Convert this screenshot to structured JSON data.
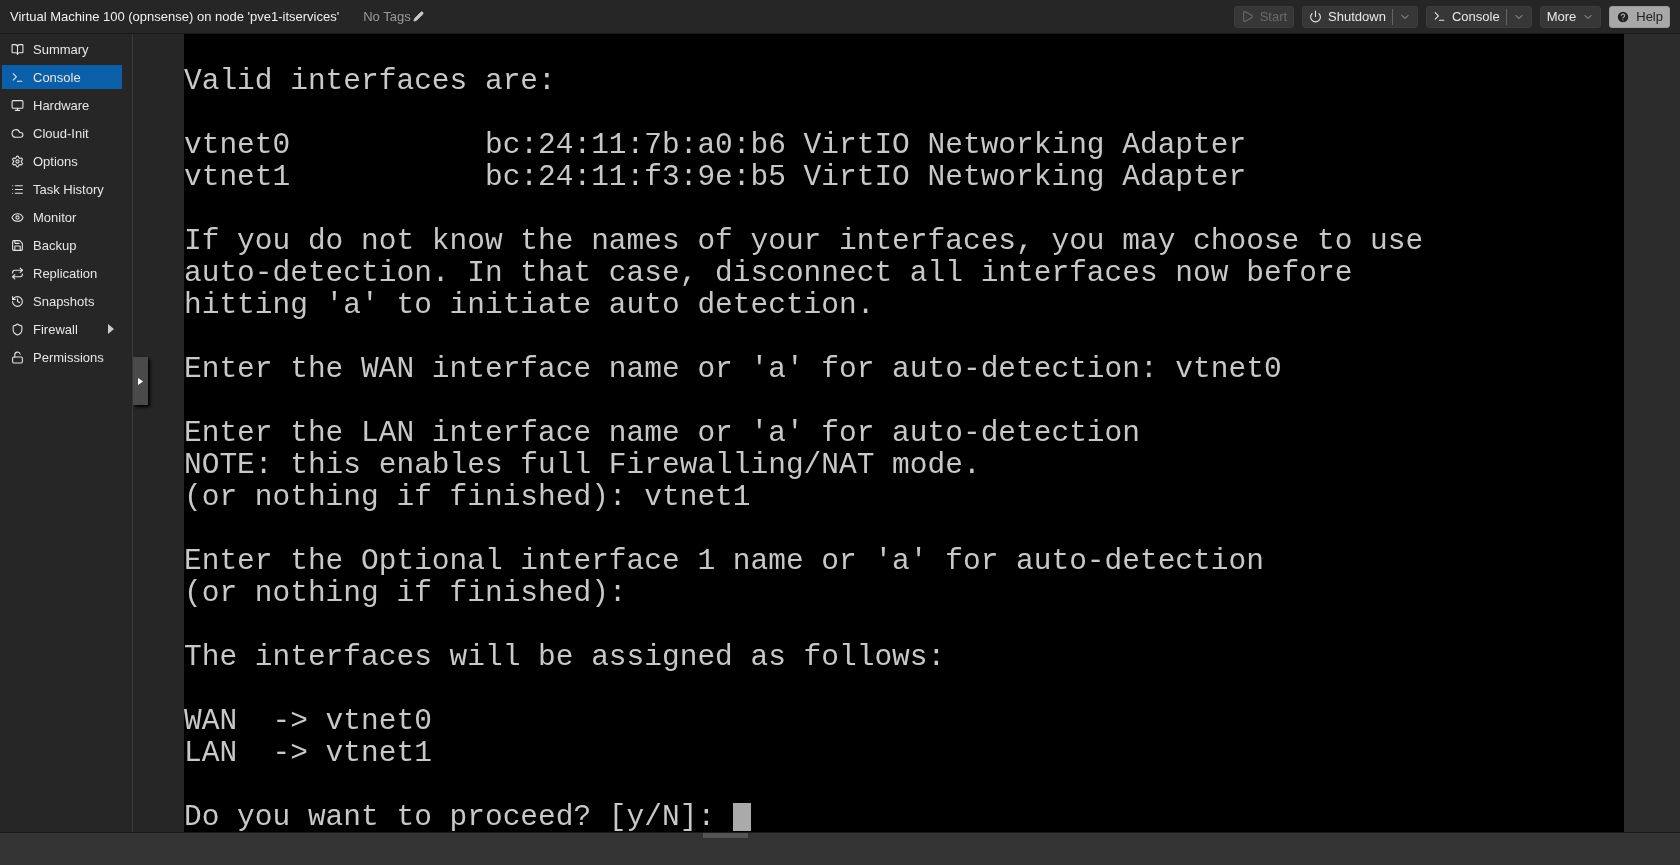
{
  "header": {
    "title": "Virtual Machine 100 (opnsense) on node 'pve1-itservices'",
    "tags": "No Tags"
  },
  "toolbar": [
    {
      "kind": "start",
      "label": "Start",
      "disabled": true,
      "split": false
    },
    {
      "kind": "shutdown",
      "label": "Shutdown",
      "disabled": false,
      "split": true
    },
    {
      "kind": "console",
      "label": "Console",
      "disabled": false,
      "split": true
    },
    {
      "kind": "more",
      "label": "More",
      "disabled": false,
      "split": false
    },
    {
      "kind": "help",
      "label": "Help",
      "disabled": false,
      "split": false
    }
  ],
  "sidebar": {
    "items": [
      {
        "kind": "summary",
        "label": "Summary",
        "selected": false
      },
      {
        "kind": "console",
        "label": "Console",
        "selected": true
      },
      {
        "kind": "hardware",
        "label": "Hardware",
        "selected": false
      },
      {
        "kind": "cloud",
        "label": "Cloud-Init",
        "selected": false
      },
      {
        "kind": "options",
        "label": "Options",
        "selected": false
      },
      {
        "kind": "tasks",
        "label": "Task History",
        "selected": false
      },
      {
        "kind": "monitor",
        "label": "Monitor",
        "selected": false
      },
      {
        "kind": "backup",
        "label": "Backup",
        "selected": false
      },
      {
        "kind": "replication",
        "label": "Replication",
        "selected": false
      },
      {
        "kind": "snapshots",
        "label": "Snapshots",
        "selected": false
      },
      {
        "kind": "firewall",
        "label": "Firewall",
        "selected": false,
        "submenu": true
      },
      {
        "kind": "permissions",
        "label": "Permissions",
        "selected": false
      }
    ]
  },
  "console": {
    "paragraphs": [
      [
        "Valid interfaces are:"
      ],
      [
        "vtnet0           bc:24:11:7b:a0:b6 VirtIO Networking Adapter",
        "vtnet1           bc:24:11:f3:9e:b5 VirtIO Networking Adapter"
      ],
      [
        "If you do not know the names of your interfaces, you may choose to use",
        "auto-detection. In that case, disconnect all interfaces now before",
        "hitting 'a' to initiate auto detection."
      ],
      [
        "Enter the WAN interface name or 'a' for auto-detection: vtnet0"
      ],
      [
        "Enter the LAN interface name or 'a' for auto-detection",
        "NOTE: this enables full Firewalling/NAT mode.",
        "(or nothing if finished): vtnet1"
      ],
      [
        "Enter the Optional interface 1 name or 'a' for auto-detection",
        "(or nothing if finished):"
      ],
      [
        "The interfaces will be assigned as follows:"
      ],
      [
        "WAN  -> vtnet0",
        "LAN  -> vtnet1"
      ]
    ],
    "prompt": "Do you want to proceed? [y/N]: "
  }
}
